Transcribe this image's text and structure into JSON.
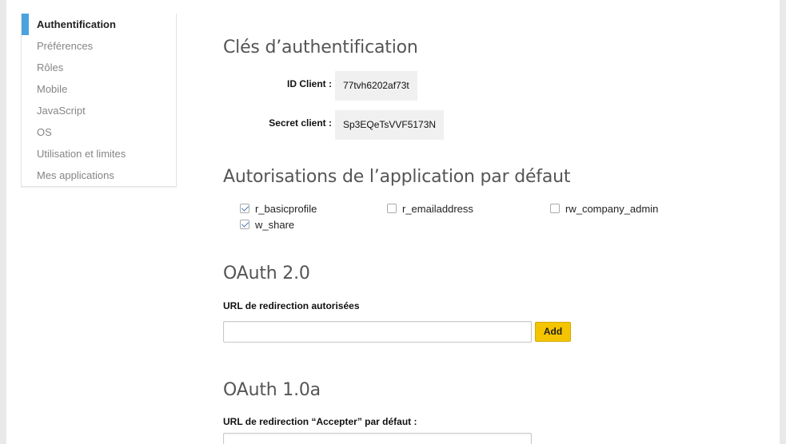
{
  "sidebar": {
    "items": [
      {
        "label": "Authentification",
        "active": true
      },
      {
        "label": "Préférences"
      },
      {
        "label": "Rôles"
      },
      {
        "label": "Mobile"
      },
      {
        "label": "JavaScript"
      },
      {
        "label": "OS"
      },
      {
        "label": "Utilisation et limites"
      },
      {
        "label": "Mes applications"
      }
    ]
  },
  "auth_keys": {
    "title": "Clés d’authentification",
    "client_id_label": "ID Client :",
    "client_id_value": "77tvh6202af73t",
    "client_secret_label": "Secret client :",
    "client_secret_value": "Sp3EQeTsVVF5173N"
  },
  "permissions": {
    "title": "Autorisations de l’application par défaut",
    "items": [
      {
        "label": "r_basicprofile",
        "checked": true
      },
      {
        "label": "r_emailaddress",
        "checked": false
      },
      {
        "label": "rw_company_admin",
        "checked": false
      },
      {
        "label": "w_share",
        "checked": true
      }
    ]
  },
  "oauth2": {
    "title": "OAuth 2.0",
    "redirect_label": "URL de redirection autorisées",
    "redirect_value": "",
    "add_label": "Add"
  },
  "oauth1": {
    "title": "OAuth 1.0a",
    "redirect_label": "URL de redirection “Accepter” par défaut :",
    "redirect_value": ""
  },
  "colors": {
    "accent": "#4aa3df",
    "add_button": "#f5c400"
  }
}
